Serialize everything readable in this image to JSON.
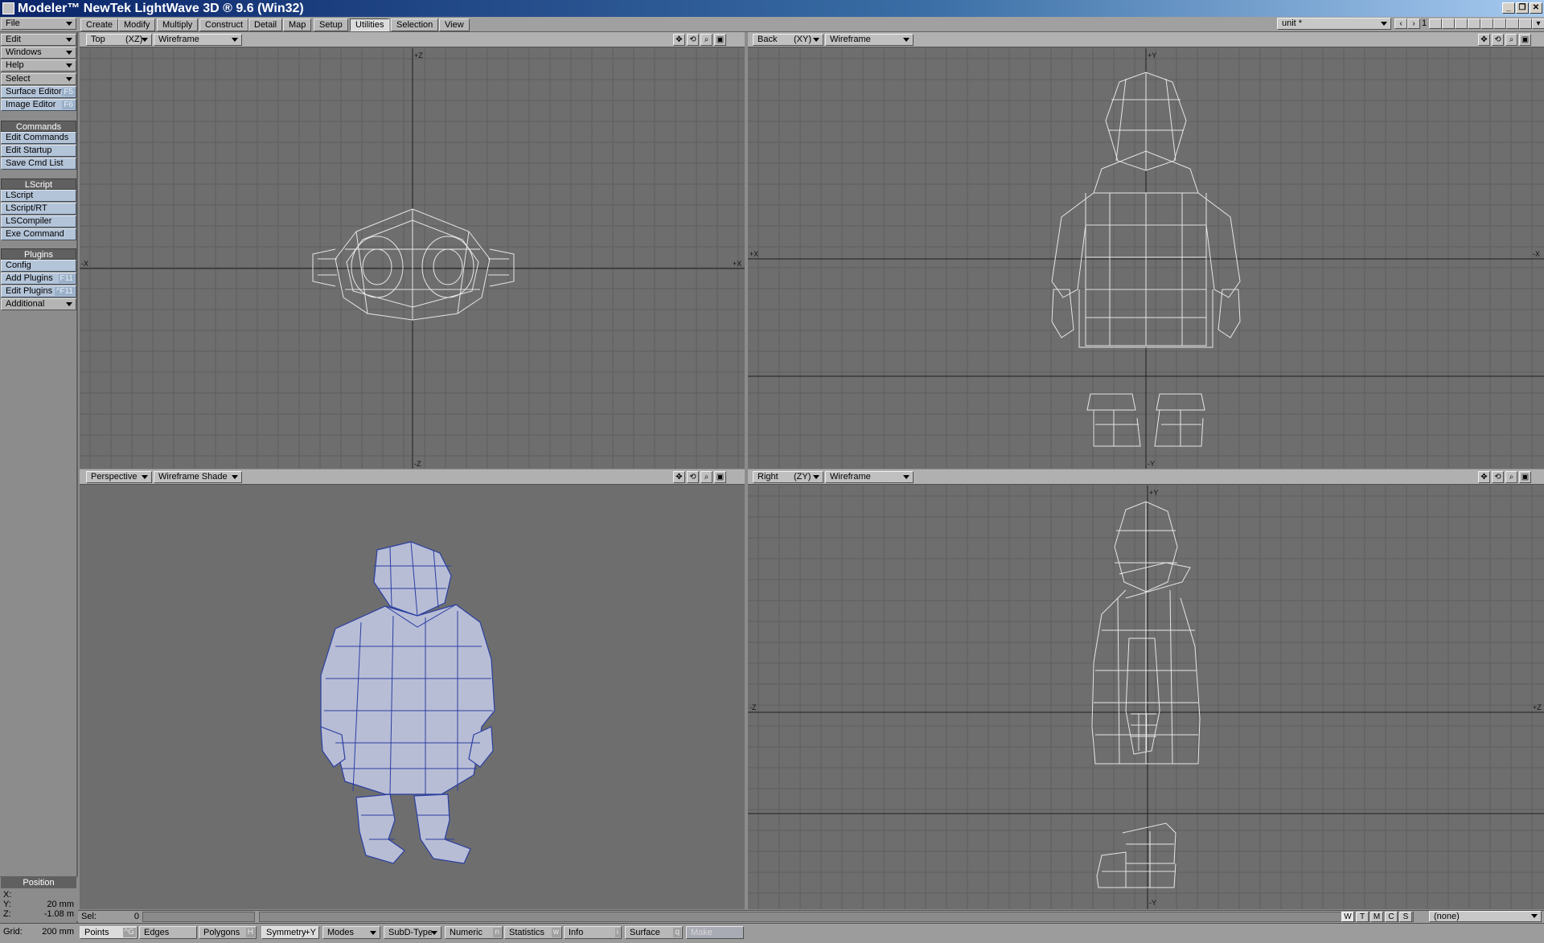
{
  "window": {
    "title": "Modeler™ NewTek LightWave 3D ® 9.6  (Win32)"
  },
  "menus": [
    {
      "label": "File"
    },
    {
      "label": "Edit"
    },
    {
      "label": "Windows"
    },
    {
      "label": "Help"
    }
  ],
  "tabs": [
    {
      "label": "Create"
    },
    {
      "label": "Modify"
    },
    {
      "label": "Multiply"
    },
    {
      "label": "Construct"
    },
    {
      "label": "Detail"
    },
    {
      "label": "Map"
    },
    {
      "label": "Setup"
    },
    {
      "label": "Utilities",
      "active": true
    },
    {
      "label": "Selection"
    },
    {
      "label": "View"
    }
  ],
  "layer": {
    "name": "unit *",
    "number": "1"
  },
  "sidebar": {
    "select_label": "Select",
    "surface_editor": {
      "label": "Surface Editor",
      "key": "F5"
    },
    "image_editor": {
      "label": "Image Editor",
      "key": "F6"
    },
    "commands_header": "Commands",
    "edit_commands": "Edit Commands",
    "edit_startup": "Edit Startup",
    "save_cmd_list": "Save Cmd List",
    "lscript_header": "LScript",
    "lscript": "LScript",
    "lscript_rt": "LScript/RT",
    "lscompiler": "LSCompiler",
    "exe_command": "Exe Command",
    "plugins_header": "Plugins",
    "config": "Config",
    "add_plugins": {
      "label": "Add Plugins",
      "key": "F11"
    },
    "edit_plugins": {
      "label": "Edit Plugins",
      "key": "^F11"
    },
    "additional": "Additional"
  },
  "position": {
    "header": "Position",
    "x_label": "X:",
    "x_value": "",
    "y_label": "Y:",
    "y_value": "20 mm",
    "z_label": "Z:",
    "z_value": "-1.08 m"
  },
  "viewports": {
    "top": {
      "view": "Top",
      "axes": "(XZ)",
      "mode": "Wireframe",
      "axis_top": "+Z",
      "axis_bottom": "-Z",
      "axis_left": "-X",
      "axis_right": "+X"
    },
    "back": {
      "view": "Back",
      "axes": "(XY)",
      "mode": "Wireframe",
      "axis_top": "+Y",
      "axis_bottom": "-Y",
      "axis_left": "+X",
      "axis_right": "-X"
    },
    "perspective": {
      "view": "Perspective",
      "mode": "Wireframe Shade"
    },
    "right": {
      "view": "Right",
      "axes": "(ZY)",
      "mode": "Wireframe",
      "axis_top": "+Y",
      "axis_bottom": "-Y",
      "axis_left": "-Z",
      "axis_right": "+Z"
    }
  },
  "status": {
    "sel_label": "Sel:",
    "sel_value": "0",
    "wtmcs": [
      "W",
      "T",
      "M",
      "C",
      "S"
    ],
    "surface_select": "(none)"
  },
  "bottom": {
    "grid_label": "Grid:",
    "grid_value": "200 mm",
    "points": {
      "label": "Points",
      "key": "^G"
    },
    "edges": {
      "label": "Edges"
    },
    "polygons": {
      "label": "Polygons",
      "key": "H"
    },
    "symmetry": "Symmetry",
    "symmetry_key": "+Y",
    "modes": "Modes",
    "subd_type": "SubD-Type",
    "numeric": {
      "label": "Numeric",
      "key": "n"
    },
    "statistics": {
      "label": "Statistics",
      "key": "w"
    },
    "info": {
      "label": "Info",
      "key": "i"
    },
    "surface": {
      "label": "Surface",
      "key": "q"
    },
    "make": "Make"
  },
  "colors": {
    "viewport_bg": "#6e6e6e",
    "grid_line": "#5e5e5e",
    "axis_line": "#1e1e1e",
    "wire": "#e6e6e6",
    "shade": "#b8bdd6",
    "shade_edge": "#2a3fa0"
  }
}
